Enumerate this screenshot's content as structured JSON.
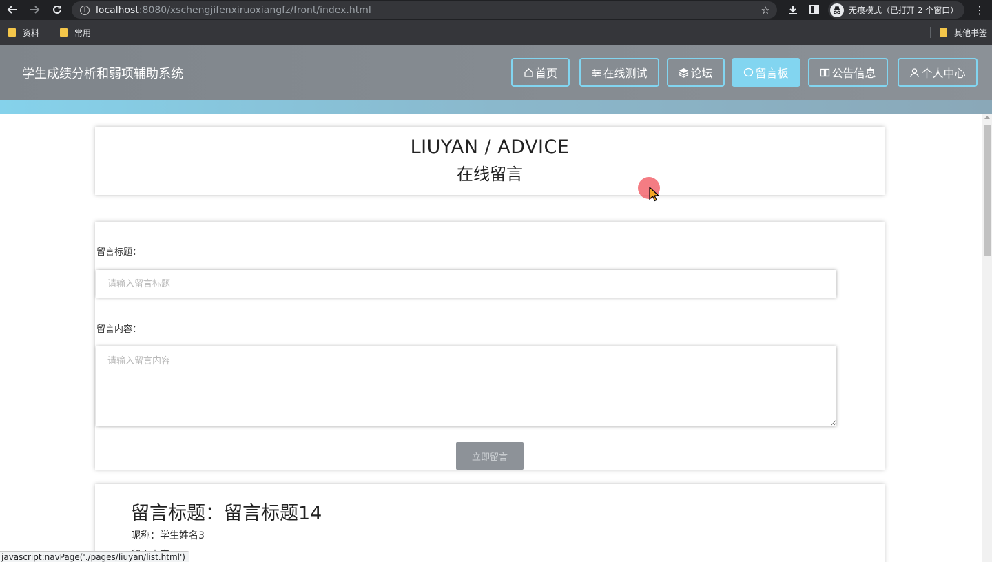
{
  "browser": {
    "url_host": "localhost",
    "url_rest": ":8080/xschengjifenxiruoxiangfz/front/index.html",
    "incognito_label": "无痕模式（已打开 2 个窗口）",
    "bookmarks": [
      "资料",
      "常用"
    ],
    "other_bookmarks": "其他书签"
  },
  "site": {
    "title": "学生成绩分析和弱项辅助系统",
    "nav": [
      {
        "icon": "home-icon",
        "label": "首页"
      },
      {
        "icon": "sliders-icon",
        "label": "在线测试"
      },
      {
        "icon": "layers-icon",
        "label": "论坛"
      },
      {
        "icon": "chat-bubble-icon",
        "label": "留言板",
        "active": true
      },
      {
        "icon": "notice-icon",
        "label": "公告信息"
      },
      {
        "icon": "user-icon",
        "label": "个人中心"
      }
    ]
  },
  "page_header": {
    "title_en": "LIUYAN / ADVICE",
    "title_zh": "在线留言"
  },
  "form": {
    "title_label": "留言标题：",
    "title_placeholder": "请输入留言标题",
    "content_label": "留言内容：",
    "content_placeholder": "请输入留言内容",
    "submit_label": "立即留言"
  },
  "messages": [
    {
      "title": "留言标题：留言标题14",
      "nick": "昵称：学生姓名3",
      "extra": "留言内容："
    }
  ],
  "status_bar": "javascript:navPage('./pages/liuyan/list.html')",
  "colors": {
    "accent": "#82d5f0",
    "header_bg": "#868c92",
    "button_bg": "#8d9298"
  }
}
